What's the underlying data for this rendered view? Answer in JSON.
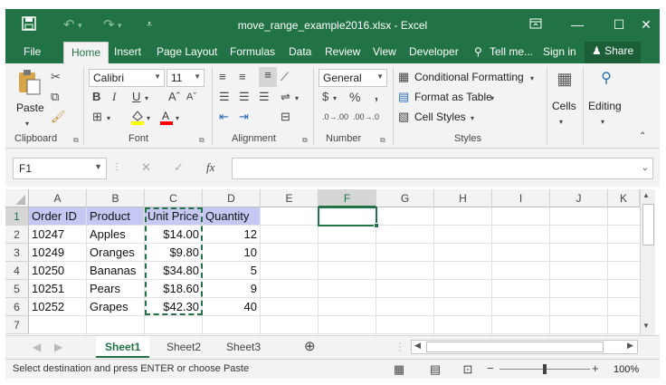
{
  "window": {
    "title": "move_range_example2016.xlsx - Excel",
    "controls": [
      "ribbon-display-icon",
      "minimize-icon",
      "maximize-icon",
      "close-icon"
    ]
  },
  "quick_access": [
    "save-icon",
    "undo-icon",
    "redo-icon",
    "customize-icon"
  ],
  "tabs": [
    "File",
    "Home",
    "Insert",
    "Page Layout",
    "Formulas",
    "Data",
    "Review",
    "View",
    "Developer"
  ],
  "active_tab": "Home",
  "tell_me": "Tell me...",
  "sign_in": "Sign in",
  "share": "Share",
  "ribbon": {
    "clipboard": {
      "paste": "Paste",
      "label": "Clipboard"
    },
    "font": {
      "name": "Calibri",
      "size": "11",
      "label": "Font",
      "bold": "B",
      "italic": "I",
      "underline": "U"
    },
    "alignment": {
      "label": "Alignment"
    },
    "number": {
      "format": "General",
      "currency": "$",
      "percent": "%",
      "comma": ",",
      "label": "Number"
    },
    "styles": {
      "conditional": "Conditional Formatting",
      "format_table": "Format as Table",
      "cell_styles": "Cell Styles",
      "label": "Styles"
    },
    "cells": {
      "label": "Cells"
    },
    "editing": {
      "label": "Editing"
    }
  },
  "formula_bar": {
    "name_box": "F1",
    "fx": "fx",
    "content": ""
  },
  "columns": [
    "A",
    "B",
    "C",
    "D",
    "E",
    "F",
    "G",
    "H",
    "I",
    "J",
    "K"
  ],
  "selected_column": "F",
  "rows": [
    "1",
    "2",
    "3",
    "4",
    "5",
    "6",
    "7"
  ],
  "sheet": {
    "header": [
      "Order ID",
      "Product",
      "Unit Price",
      "Quantity"
    ],
    "data": [
      [
        "10247",
        "Apples",
        "$14.00",
        "12"
      ],
      [
        "10249",
        "Oranges",
        "$9.80",
        "10"
      ],
      [
        "10250",
        "Bananas",
        "$34.80",
        "5"
      ],
      [
        "10251",
        "Pears",
        "$18.60",
        "9"
      ],
      [
        "10252",
        "Grapes",
        "$42.30",
        "40"
      ]
    ]
  },
  "sheet_tabs": [
    "Sheet1",
    "Sheet2",
    "Sheet3"
  ],
  "active_sheet": "Sheet1",
  "status": {
    "message": "Select destination and press ENTER or choose Paste",
    "zoom": "100%"
  },
  "colors": {
    "excel_green": "#217346",
    "header_fill": "#c5c8f2"
  }
}
